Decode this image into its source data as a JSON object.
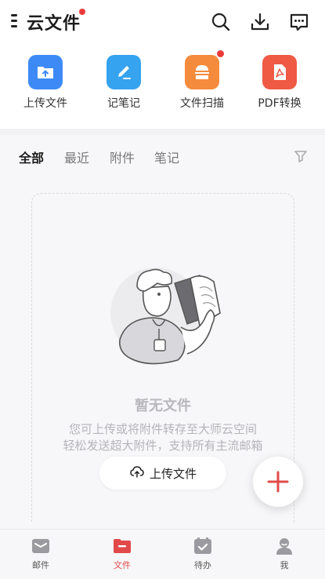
{
  "header": {
    "title": "云文件",
    "icons": [
      "menu-icon",
      "search-icon",
      "download-icon",
      "message-icon"
    ]
  },
  "quick_actions": [
    {
      "label": "上传文件",
      "icon": "folder-upload-icon",
      "color": "#3d8af7"
    },
    {
      "label": "记笔记",
      "icon": "note-pen-icon",
      "color": "#35a3f0"
    },
    {
      "label": "文件扫描",
      "icon": "scanner-icon",
      "color": "#f58b3c"
    },
    {
      "label": "PDF转换",
      "icon": "pdf-icon",
      "color": "#ef5a45"
    }
  ],
  "tabs": [
    {
      "label": "全部",
      "active": true
    },
    {
      "label": "最近",
      "active": false
    },
    {
      "label": "附件",
      "active": false
    },
    {
      "label": "笔记",
      "active": false
    }
  ],
  "empty_state": {
    "title": "暂无文件",
    "desc_line1": "您可上传或将附件转存至大师云空间",
    "desc_line2": "轻松发送超大附件，支持所有主流邮箱",
    "button_label": "上传文件"
  },
  "bottom_nav": [
    {
      "label": "邮件",
      "icon": "mail-icon",
      "active": false
    },
    {
      "label": "文件",
      "icon": "folder-icon",
      "active": true
    },
    {
      "label": "待办",
      "icon": "todo-icon",
      "active": false
    },
    {
      "label": "我",
      "icon": "profile-icon",
      "active": false
    }
  ],
  "colors": {
    "accent": "#e24a4a",
    "badge": "#ea3b3b",
    "background": "#f7f7f9"
  }
}
